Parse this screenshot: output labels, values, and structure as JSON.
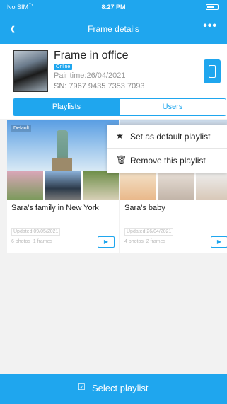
{
  "status_bar": {
    "carrier": "No SIM",
    "time": "8:27 PM"
  },
  "header": {
    "title": "Frame details"
  },
  "frame": {
    "name": "Frame in office",
    "status": "Online",
    "pair_time": "Pair time:26/04/2021",
    "serial": "SN: 7967 9435 7353 7093"
  },
  "tabs": [
    {
      "label": "Playlists",
      "active": true
    },
    {
      "label": "Users",
      "active": false
    }
  ],
  "playlists": [
    {
      "tag": "Default",
      "name": "Sara's family in New York",
      "updated": "Updated:09/05/2021",
      "photos": "6 photos",
      "frames": "1 frames"
    },
    {
      "name": "Sara's baby",
      "updated": "Updated:26/04/2021",
      "photos": "4 photos",
      "frames": "2 frames"
    }
  ],
  "context_menu": {
    "items": [
      {
        "label": "Set as default playlist",
        "icon": "star-icon"
      },
      {
        "label": "Remove this playlist",
        "icon": "trash-icon"
      }
    ]
  },
  "bottom_action": {
    "label": "Select playlist",
    "icon": "checkbox-icon"
  },
  "colors": {
    "primary": "#1fa6ee"
  }
}
